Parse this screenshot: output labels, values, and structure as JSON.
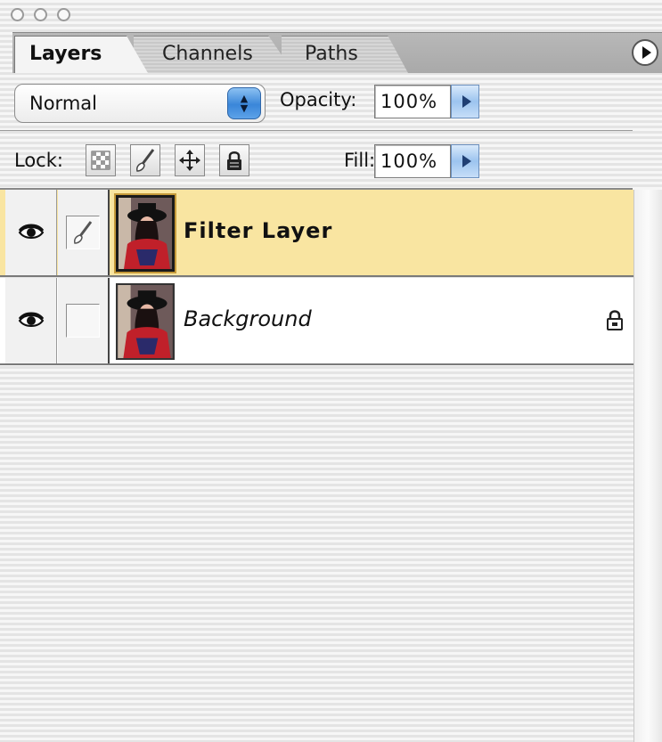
{
  "window": {
    "buttons": [
      "close",
      "minimize",
      "zoom"
    ]
  },
  "tabs": [
    {
      "label": "Layers",
      "active": true
    },
    {
      "label": "Channels",
      "active": false
    },
    {
      "label": "Paths",
      "active": false
    }
  ],
  "blend": {
    "mode": "Normal",
    "opacity_label": "Opacity:",
    "opacity_value": "100%"
  },
  "lock": {
    "label": "Lock:",
    "icons": [
      "lock-transparency-icon",
      "lock-image-icon",
      "lock-position-icon",
      "lock-all-icon"
    ],
    "fill_label": "Fill:",
    "fill_value": "100%"
  },
  "layers": [
    {
      "name": "Filter Layer",
      "visible": true,
      "selected": true,
      "locked": false,
      "style": "bold"
    },
    {
      "name": "Background",
      "visible": true,
      "selected": false,
      "locked": true,
      "style": "italic"
    }
  ],
  "colors": {
    "selected_row": "#f9e5a1",
    "accent_blue": "#3a86d9"
  }
}
